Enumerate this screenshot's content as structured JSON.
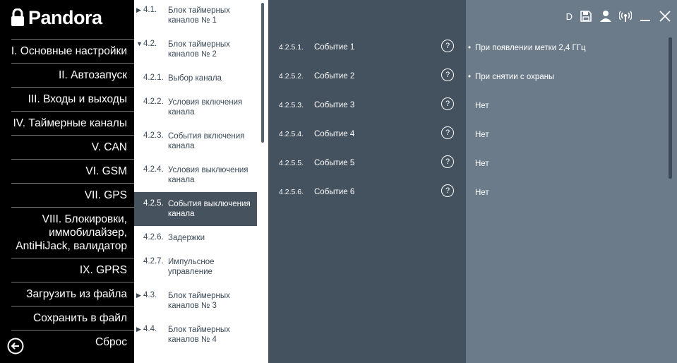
{
  "brand": {
    "name": "Pandora"
  },
  "sidebar": {
    "items": [
      {
        "label": "I. Основные настройки"
      },
      {
        "label": "II. Автозапуск"
      },
      {
        "label": "III. Входы и выходы"
      },
      {
        "label": "IV. Таймерные каналы"
      },
      {
        "label": "V. CAN"
      },
      {
        "label": "VI. GSM"
      },
      {
        "label": "VII. GPS"
      },
      {
        "label": "VIII. Блокировки, иммобилайзер, AntiHiJack, валидатор"
      },
      {
        "label": "IX. GPRS"
      },
      {
        "label": "Загрузить из файла"
      },
      {
        "label": "Сохранить в файл"
      },
      {
        "label": "Сброс"
      }
    ]
  },
  "nav": {
    "items": [
      {
        "num": "4.1.",
        "label": "Блок таймерных каналов № 1"
      },
      {
        "num": "4.2.",
        "label": "Блок таймерных каналов № 2"
      },
      {
        "num": "4.2.1.",
        "label": "Выбор канала"
      },
      {
        "num": "4.2.2.",
        "label": "Условия включения канала"
      },
      {
        "num": "4.2.3.",
        "label": "События включения канала"
      },
      {
        "num": "4.2.4.",
        "label": "Условия выключения канала"
      },
      {
        "num": "4.2.5.",
        "label": "События выключения канала"
      },
      {
        "num": "4.2.6.",
        "label": "Задержки"
      },
      {
        "num": "4.2.7.",
        "label": "Импульсное управление"
      },
      {
        "num": "4.3.",
        "label": "Блок таймерных каналов № 3"
      },
      {
        "num": "4.4.",
        "label": "Блок таймерных каналов № 4"
      }
    ]
  },
  "events": {
    "items": [
      {
        "num": "4.2.5.1.",
        "label": "Событие 1",
        "value": "При появлении метки 2,4 ГГц"
      },
      {
        "num": "4.2.5.2.",
        "label": "Событие 2",
        "value": "При снятии с охраны"
      },
      {
        "num": "4.2.5.3.",
        "label": "Событие 3",
        "value": "Нет"
      },
      {
        "num": "4.2.5.4.",
        "label": "Событие 4",
        "value": "Нет"
      },
      {
        "num": "4.2.5.5.",
        "label": "Событие 5",
        "value": "Нет"
      },
      {
        "num": "4.2.5.6.",
        "label": "Событие 6",
        "value": "Нет"
      }
    ],
    "help_glyph": "?"
  },
  "topbar": {
    "d_label": "D"
  },
  "colors": {
    "sidebar": "#000000",
    "active": "#46525e",
    "events_bg": "#44525f",
    "right_bg": "#6b7b89"
  }
}
